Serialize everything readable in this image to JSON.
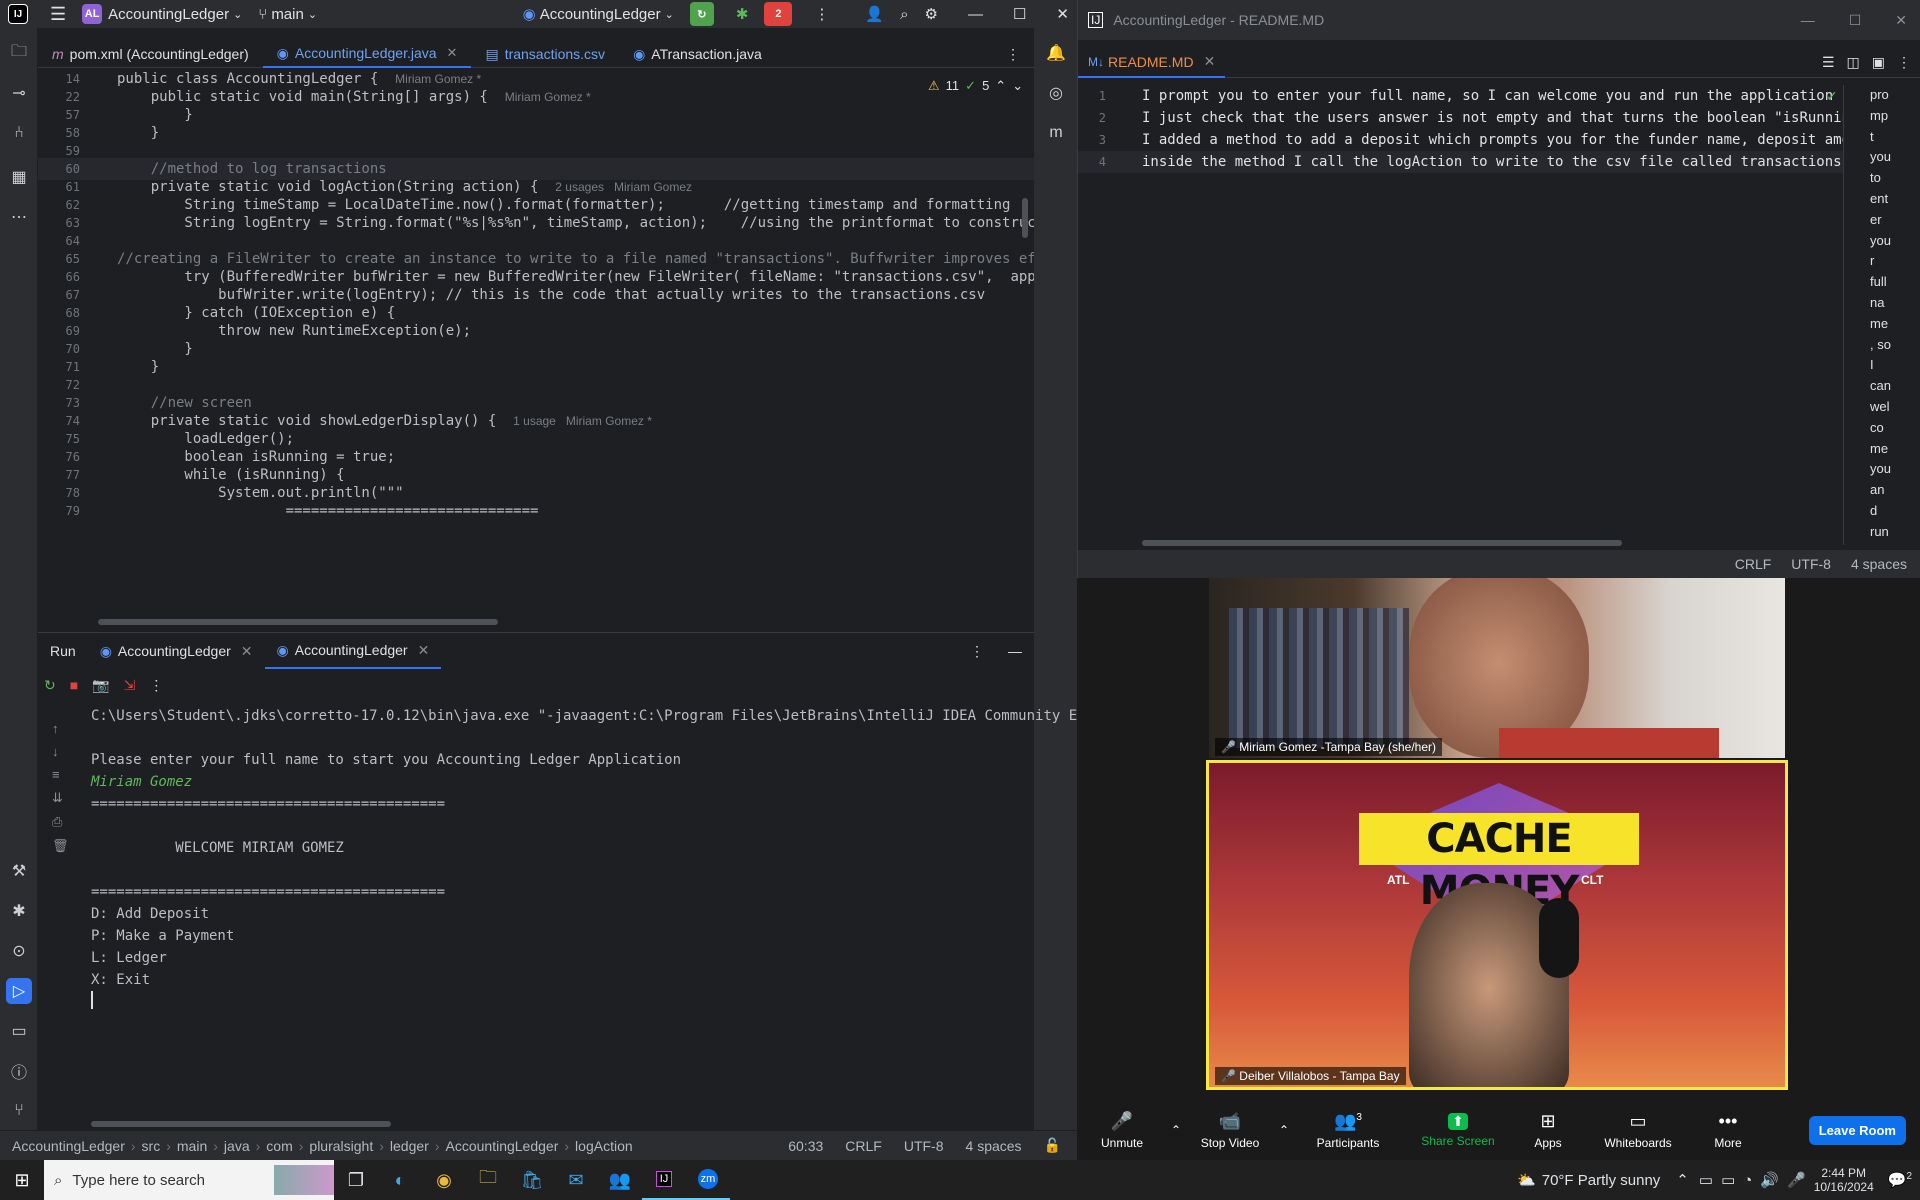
{
  "ide": {
    "project_badge": "AL",
    "project": "AccountingLedger",
    "branch": "main",
    "run_config": "AccountingLedger",
    "update_count": "2",
    "tabs": [
      {
        "label": "pom.xml (AccountingLedger)",
        "prefix": "m"
      },
      {
        "label": "AccountingLedger.java",
        "active": true
      },
      {
        "label": "transactions.csv"
      },
      {
        "label": "ATransaction.java"
      }
    ],
    "inspection": {
      "warnings": "11",
      "ok": "5"
    },
    "code_lines": [
      {
        "n": "14",
        "text": "public class AccountingLedger {  ",
        "hint": "Miriam Gomez *"
      },
      {
        "n": "22",
        "text": "    public static void main(String[] args) {  ",
        "hint": "Miriam Gomez *"
      },
      {
        "n": "57",
        "text": "        }"
      },
      {
        "n": "58",
        "text": "    }"
      },
      {
        "n": "59",
        "text": ""
      },
      {
        "n": "60",
        "text": "    //method to log transactions"
      },
      {
        "n": "61",
        "text": "    private static void logAction(String action) {  ",
        "hint": "2 usages   Miriam Gomez"
      },
      {
        "n": "62",
        "text": "        String timeStamp = LocalDateTime.now().format(formatter);       //getting timestamp and formatting"
      },
      {
        "n": "63",
        "text": "        String logEntry = String.format(\"%s|%s%n\", timeStamp, action);    //using the printformat to construct a lo"
      },
      {
        "n": "64",
        "text": ""
      },
      {
        "n": "65",
        "text": "//creating a FileWriter to create an instance to write to a file named \"transactions\". Buffwriter improves efficier"
      },
      {
        "n": "66",
        "text": "        try (BufferedWriter bufWriter = new BufferedWriter(new FileWriter( fileName: \"transactions.csv\",  append: true)"
      },
      {
        "n": "67",
        "text": "            bufWriter.write(logEntry); // this is the code that actually writes to the transactions.csv"
      },
      {
        "n": "68",
        "text": "        } catch (IOException e) {"
      },
      {
        "n": "69",
        "text": "            throw new RuntimeException(e);"
      },
      {
        "n": "70",
        "text": "        }"
      },
      {
        "n": "71",
        "text": "    }"
      },
      {
        "n": "72",
        "text": ""
      },
      {
        "n": "73",
        "text": "    //new screen"
      },
      {
        "n": "74",
        "text": "    private static void showLedgerDisplay() {  ",
        "hint": "1 usage   Miriam Gomez *"
      },
      {
        "n": "75",
        "text": "        loadLedger();"
      },
      {
        "n": "76",
        "text": "        boolean isRunning = true;"
      },
      {
        "n": "77",
        "text": "        while (isRunning) {"
      },
      {
        "n": "78",
        "text": "            System.out.println(\"\"\""
      },
      {
        "n": "79",
        "text": "                    =============================="
      }
    ],
    "run": {
      "label": "Run",
      "tabs": [
        "AccountingLedger",
        "AccountingLedger"
      ],
      "console": [
        "C:\\Users\\Student\\.jdks\\corretto-17.0.12\\bin\\java.exe \"-javaagent:C:\\Program Files\\JetBrains\\IntelliJ IDEA Community Ed",
        "",
        "Please enter your full name to start you Accounting Ledger Application",
        "Miriam Gomez",
        "==========================================",
        "",
        "          WELCOME MIRIAM GOMEZ",
        "",
        "==========================================",
        "D: Add Deposit",
        "P: Make a Payment",
        "L: Ledger",
        "X: Exit"
      ]
    },
    "breadcrumb": [
      "AccountingLedger",
      "src",
      "main",
      "java",
      "com",
      "pluralsight",
      "ledger",
      "AccountingLedger",
      "logAction"
    ],
    "status": {
      "position": "60:33",
      "line_sep": "CRLF",
      "encoding": "UTF-8",
      "indent": "4 spaces"
    }
  },
  "readme": {
    "title": "AccountingLedger - README.MD",
    "tab_label": "README.MD",
    "tab_prefix": "M↓",
    "lines": [
      "I prompt you to enter your full name, so I can welcome you and run the application",
      "I just check that the users answer is not empty and that turns the boolean \"isRunning to",
      "I added a method to add a deposit which prompts you for the funder name, deposit amount,",
      "inside the method I call the logAction to write to the csv file called transactions"
    ],
    "preview_words": [
      "pro",
      "mp",
      "t",
      "you",
      "to",
      "ent",
      "er",
      "you",
      "r",
      "full",
      "na",
      "me",
      ", so",
      "I",
      "can",
      "wel",
      "co",
      "me",
      "you",
      "an",
      "d",
      "run"
    ],
    "status": {
      "line_sep": "CRLF",
      "encoding": "UTF-8",
      "indent": "4 spaces"
    }
  },
  "zoom": {
    "participant1": "Miriam Gomez -Tampa Bay (she/her)",
    "participant2": "Deiber Villalobos - Tampa Bay",
    "bg_text": "CACHE MONEY",
    "bg_left": "ATL",
    "bg_right": "CLT",
    "buttons": {
      "unmute": "Unmute",
      "stop_video": "Stop Video",
      "participants": "Participants",
      "participants_count": "3",
      "share": "Share Screen",
      "apps": "Apps",
      "whiteboards": "Whiteboards",
      "more": "More",
      "leave": "Leave Room"
    }
  },
  "taskbar": {
    "search_placeholder": "Type here to search",
    "weather": "70°F  Partly sunny",
    "time": "2:44 PM",
    "date": "10/16/2024",
    "notifications": "2"
  },
  "colors": {
    "accent": "#3574f0",
    "zoom_share": "#0cbc4c",
    "zoom_leave": "#0e71eb"
  }
}
